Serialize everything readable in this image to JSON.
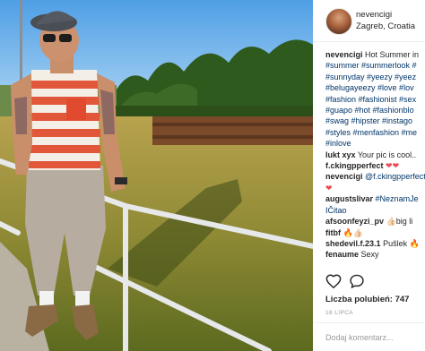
{
  "header": {
    "username": "nevencigi",
    "location": "Zagreb, Croatia"
  },
  "caption": {
    "username": "nevencigi",
    "lines": [
      "Hot Summer in",
      "#summer #summerlook #",
      "#sunnyday #yeezy #yeez",
      "#belugayeezy #love #lov",
      "#fashion #fashionist #sex",
      "#guapo #hot #fashionblo",
      "#swag #hipster #instago",
      "#styles #menfashion #me",
      "#inlove"
    ]
  },
  "comments": [
    {
      "user": "lukt xyx",
      "text": "Your pic is cool.."
    },
    {
      "user": "f.ckingpperfect",
      "text": "❤❤"
    },
    {
      "user": "nevencigi",
      "text": "@f.ckingpperfect"
    },
    {
      "user": "",
      "text": "❤"
    },
    {
      "user": "augustslivar",
      "text": "#NeznamJe"
    },
    {
      "user": "",
      "text": "IČitao"
    },
    {
      "user": "afsoonfeyzi_pv",
      "text": "👍🏻big li"
    },
    {
      "user": "fitbf",
      "text": "🔥👍🏻"
    },
    {
      "user": "shedevil.f.23.1",
      "text": "Pušlek 🔥"
    },
    {
      "user": "fenaume",
      "text": "Sexy"
    }
  ],
  "actions": {
    "like_icon": "heart-icon",
    "comment_icon": "comment-icon"
  },
  "likes": {
    "label": "Liczba polubień:",
    "count": "747"
  },
  "date": "18 LIPCA",
  "add_comment": {
    "placeholder": "Dodaj komentarz..."
  },
  "colors": {
    "like_red": "#ed4956",
    "hashtag_blue": "#003569",
    "text": "#262626",
    "muted": "#999999"
  }
}
